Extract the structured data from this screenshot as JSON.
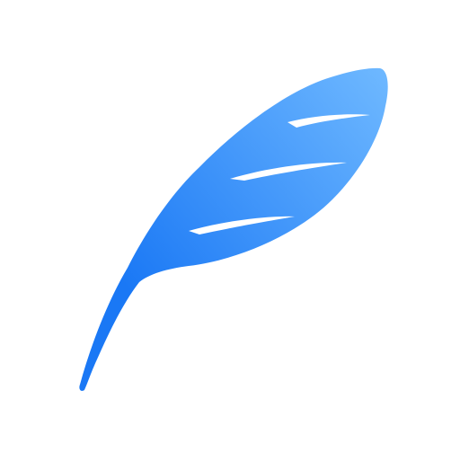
{
  "icon": {
    "name": "feather-icon",
    "gradient": {
      "light": "#6EB8FF",
      "dark": "#1A78F5"
    },
    "slit_color": "#FFFFFF"
  },
  "background": "#FFFFFF"
}
